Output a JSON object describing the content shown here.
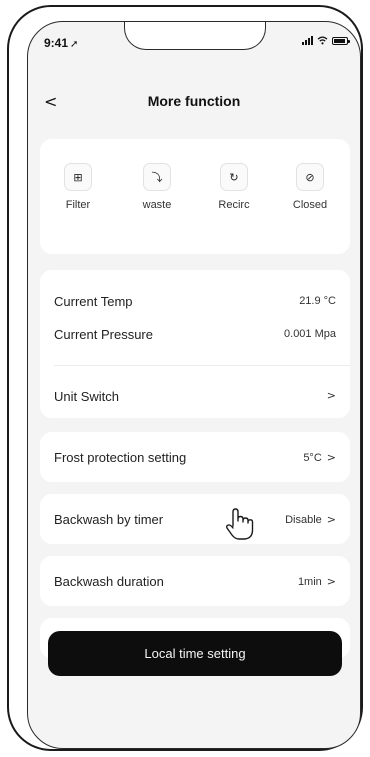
{
  "status_bar": {
    "time": "9:41",
    "signal_icon": "signal-icon",
    "wifi_icon": "wifi-icon",
    "battery_icon": "battery-icon"
  },
  "header": {
    "back_icon": "<",
    "title": "More function"
  },
  "functions": [
    {
      "label": "Filter",
      "icon": "filter-icon",
      "glyph": "⊞"
    },
    {
      "label": "waste",
      "icon": "waste-icon",
      "glyph": "⤵"
    },
    {
      "label": "Recirc",
      "icon": "recirc-icon",
      "glyph": "↻"
    },
    {
      "label": "Closed",
      "icon": "closed-icon",
      "glyph": "⊘"
    }
  ],
  "readings": {
    "current_temp_label": "Current Temp",
    "current_temp_value": "21.9 °C",
    "current_pressure_label": "Current Pressure",
    "current_pressure_value": "0.001 Mpa",
    "unit_switch_label": "Unit Switch"
  },
  "settings": {
    "frost_label": "Frost protection setting",
    "frost_value": "5°C",
    "backwash_timer_label": "Backwash by timer",
    "backwash_timer_value": "Disable",
    "backwash_duration_label": "Backwash duration",
    "backwash_duration_value": "1min"
  },
  "chevron": ">",
  "bottom_button": {
    "label": "Local time setting"
  },
  "colors": {
    "background": "#f4f4f4",
    "card": "#ffffff",
    "button": "#0d0d0d",
    "button_text": "#f5f5f5"
  }
}
